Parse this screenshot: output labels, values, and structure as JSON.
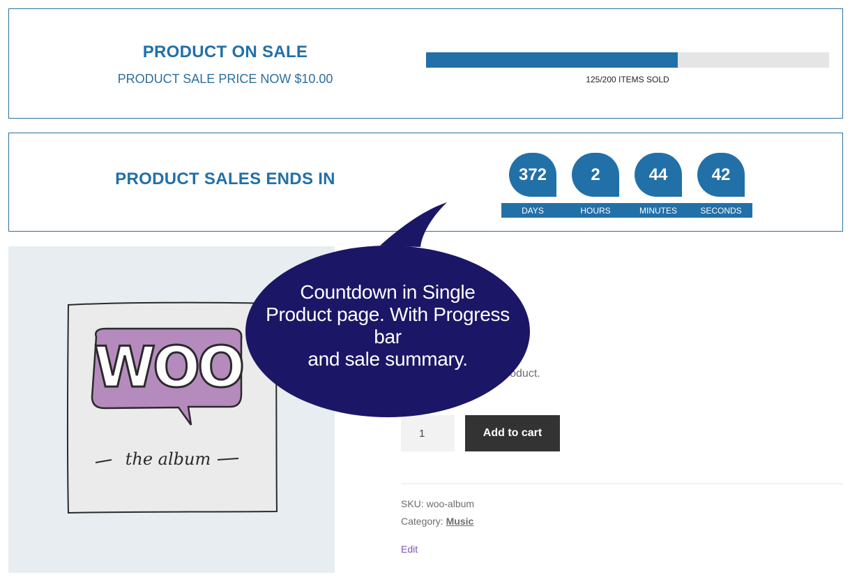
{
  "sale": {
    "title": "PRODUCT ON SALE",
    "price_text": "PRODUCT SALE PRICE NOW $10.00",
    "progress": {
      "sold": 125,
      "total": 200,
      "label": "125/200 ITEMS SOLD"
    }
  },
  "countdown": {
    "title": "PRODUCT SALES ENDS IN",
    "units": [
      {
        "value": "372",
        "label": "DAYS"
      },
      {
        "value": "2",
        "label": "HOURS"
      },
      {
        "value": "44",
        "label": "MINUTES"
      },
      {
        "value": "42",
        "label": "SECONDS"
      }
    ]
  },
  "product": {
    "image": {
      "logo_text": "WOO",
      "caption": "the album"
    },
    "description_tail": "al product.",
    "quantity": "1",
    "add_to_cart_label": "Add to cart",
    "sku_label": "SKU:",
    "sku_value": "woo-album",
    "category_label": "Category:",
    "category_value": "Music",
    "edit_label": "Edit"
  },
  "callout": {
    "lines": [
      "Countdown in Single",
      "Product page. With Progress",
      "bar",
      "and sale summary."
    ]
  },
  "colors": {
    "accent": "#2270a8",
    "callout_bg": "#1c1666",
    "button_bg": "#333333",
    "edit_link": "#7f54b3"
  }
}
